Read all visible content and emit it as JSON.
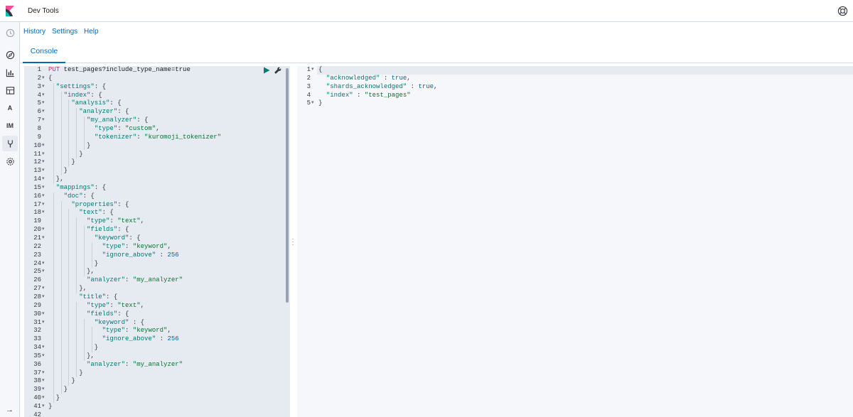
{
  "header": {
    "title": "Dev Tools"
  },
  "nav": {
    "text_icons": [
      "A",
      "IM"
    ],
    "collapse_glyph": "→"
  },
  "menu": {
    "history": "History",
    "settings": "Settings",
    "help": "Help"
  },
  "tabs": [
    {
      "label": "Console"
    }
  ],
  "request": {
    "lines": [
      {
        "n": "1",
        "fold": false,
        "html": "<span class=\"k\">PUT</span> <span class=\"u\">test_pages?include_type_name=true</span>"
      },
      {
        "n": "2",
        "fold": true,
        "html": "{"
      },
      {
        "n": "3",
        "fold": true,
        "html": "  <span class=\"s\">\"settings\"</span>: {"
      },
      {
        "n": "4",
        "fold": true,
        "html": "    <span class=\"s\">\"index\"</span>: {"
      },
      {
        "n": "5",
        "fold": true,
        "html": "      <span class=\"s\">\"analysis\"</span>: {"
      },
      {
        "n": "6",
        "fold": true,
        "html": "        <span class=\"s\">\"analyzer\"</span>: {"
      },
      {
        "n": "7",
        "fold": true,
        "html": "          <span class=\"s\">\"my_analyzer\"</span>: {"
      },
      {
        "n": "8",
        "fold": false,
        "html": "            <span class=\"s\">\"type\"</span>: <span class=\"str\">\"custom\"</span>,"
      },
      {
        "n": "9",
        "fold": false,
        "html": "            <span class=\"s\">\"tokenizer\"</span>: <span class=\"str\">\"kuromoji_tokenizer\"</span>"
      },
      {
        "n": "10",
        "fold": true,
        "html": "          }"
      },
      {
        "n": "11",
        "fold": true,
        "html": "        }"
      },
      {
        "n": "12",
        "fold": true,
        "html": "      }"
      },
      {
        "n": "13",
        "fold": true,
        "html": "    }"
      },
      {
        "n": "14",
        "fold": true,
        "html": "  },"
      },
      {
        "n": "15",
        "fold": true,
        "html": "  <span class=\"s\">\"mappings\"</span>: {"
      },
      {
        "n": "16",
        "fold": true,
        "html": "    <span class=\"s\">\"doc\"</span>: {"
      },
      {
        "n": "17",
        "fold": true,
        "html": "      <span class=\"s\">\"properties\"</span>: {"
      },
      {
        "n": "18",
        "fold": true,
        "html": "        <span class=\"s\">\"text\"</span>: {"
      },
      {
        "n": "19",
        "fold": false,
        "html": "          <span class=\"s\">\"type\"</span>: <span class=\"str\">\"text\"</span>,"
      },
      {
        "n": "20",
        "fold": true,
        "html": "          <span class=\"s\">\"fields\"</span>: {"
      },
      {
        "n": "21",
        "fold": true,
        "html": "            <span class=\"s\">\"keyword\"</span>: {"
      },
      {
        "n": "22",
        "fold": false,
        "html": "              <span class=\"s\">\"type\"</span>: <span class=\"str\">\"keyword\"</span>,"
      },
      {
        "n": "23",
        "fold": false,
        "html": "              <span class=\"s\">\"ignore_above\"</span> : <span class=\"n\">256</span>"
      },
      {
        "n": "24",
        "fold": true,
        "html": "            }"
      },
      {
        "n": "25",
        "fold": true,
        "html": "          },"
      },
      {
        "n": "26",
        "fold": false,
        "html": "          <span class=\"s\">\"analyzer\"</span>: <span class=\"str\">\"my_analyzer\"</span>"
      },
      {
        "n": "27",
        "fold": true,
        "html": "        },"
      },
      {
        "n": "28",
        "fold": true,
        "html": "        <span class=\"s\">\"title\"</span>: {"
      },
      {
        "n": "29",
        "fold": false,
        "html": "          <span class=\"s\">\"type\"</span>: <span class=\"str\">\"text\"</span>,"
      },
      {
        "n": "30",
        "fold": true,
        "html": "          <span class=\"s\">\"fields\"</span>: {"
      },
      {
        "n": "31",
        "fold": true,
        "html": "            <span class=\"s\">\"keyword\"</span> : {"
      },
      {
        "n": "32",
        "fold": false,
        "html": "              <span class=\"s\">\"type\"</span>: <span class=\"str\">\"keyword\"</span>,"
      },
      {
        "n": "33",
        "fold": false,
        "html": "              <span class=\"s\">\"ignore_above\"</span> : <span class=\"n\">256</span>"
      },
      {
        "n": "34",
        "fold": true,
        "html": "            }"
      },
      {
        "n": "35",
        "fold": true,
        "html": "          },"
      },
      {
        "n": "36",
        "fold": false,
        "html": "          <span class=\"s\">\"analyzer\"</span>: <span class=\"str\">\"my_analyzer\"</span>"
      },
      {
        "n": "37",
        "fold": true,
        "html": "        }"
      },
      {
        "n": "38",
        "fold": true,
        "html": "      }"
      },
      {
        "n": "39",
        "fold": true,
        "html": "    }"
      },
      {
        "n": "40",
        "fold": true,
        "html": "  }"
      },
      {
        "n": "41",
        "fold": true,
        "html": "}"
      },
      {
        "n": "42",
        "fold": false,
        "html": ""
      }
    ]
  },
  "response": {
    "lines": [
      {
        "n": "1",
        "fold": true,
        "html": "{"
      },
      {
        "n": "2",
        "fold": false,
        "html": "  <span class=\"s\">\"acknowledged\"</span> : <span class=\"b\">true</span>,"
      },
      {
        "n": "3",
        "fold": false,
        "html": "  <span class=\"s\">\"shards_acknowledged\"</span> : <span class=\"b\">true</span>,"
      },
      {
        "n": "4",
        "fold": false,
        "html": "  <span class=\"s\">\"index\"</span> : <span class=\"str\">\"test_pages\"</span>"
      },
      {
        "n": "5",
        "fold": true,
        "html": "}"
      }
    ]
  },
  "icons": {
    "logo": "kibana-logo",
    "run": "play-icon",
    "wrench": "wrench-icon",
    "help": "help-icon"
  },
  "colors": {
    "accent": "#006bb4",
    "logo_pink": "#f04e98",
    "logo_teal": "#00bfb3",
    "method": "#b83283",
    "string": "#00752e"
  }
}
